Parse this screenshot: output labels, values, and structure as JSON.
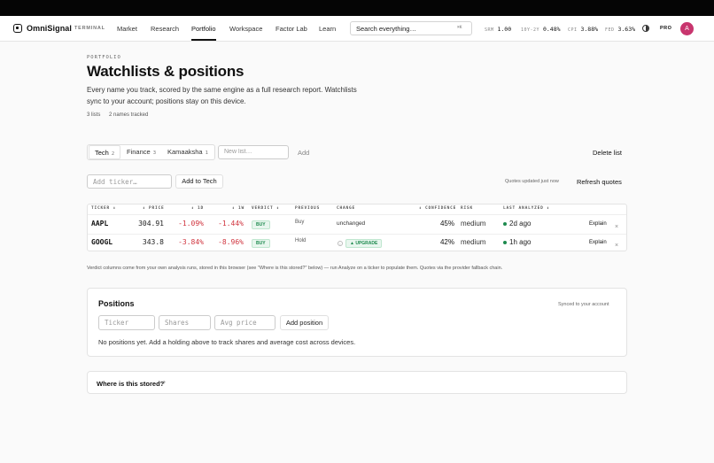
{
  "nav": {
    "brand": "OmniSignal",
    "tag": "TERMINAL",
    "links": [
      "Market",
      "Research",
      "Portfolio",
      "Workspace",
      "Factor Lab",
      "Learn"
    ],
    "active_link": "Portfolio",
    "search_placeholder": "Search everything…",
    "search_shortcut": "⌘K",
    "tickers": [
      {
        "key": "SRM",
        "value": "1.00"
      },
      {
        "key": "10Y-2Y",
        "value": "0.48%"
      },
      {
        "key": "CPI",
        "value": "3.88%"
      },
      {
        "key": "FED",
        "value": "3.63%"
      }
    ],
    "plan": "PRO",
    "avatar_initial": "A",
    "icons": {
      "logo": "omnisignal-logo-icon",
      "theme": "theme-toggle-icon"
    }
  },
  "header": {
    "eyebrow": "PORTFOLIO",
    "title": "Watchlists & positions",
    "description": "Every name you track, scored by the same engine as a full research report. Watchlists sync to your account; positions stay on this device.",
    "lists_count": "3 lists",
    "names_tracked": "2 names tracked"
  },
  "watchlists": {
    "tabs": [
      {
        "label": "Tech",
        "count": "2"
      },
      {
        "label": "Finance",
        "count": "3"
      },
      {
        "label": "Kamaaksha",
        "count": "1"
      }
    ],
    "active_tab": "Tech",
    "new_list_placeholder": "New list…",
    "add_label": "Add",
    "delete_label": "Delete list",
    "ticker_placeholder": "Add ticker…",
    "add_to_label": "Add to Tech",
    "quotes_status": "Quotes updated just now",
    "refresh_label": "Refresh quotes"
  },
  "table": {
    "headers": {
      "ticker": "TICKER ↕",
      "price": "↕ PRICE",
      "d1": "↕ 1D",
      "w1": "↕ 1W",
      "verdict": "VERDICT ↕",
      "previous": "PREVIOUS",
      "change": "CHANGE",
      "confidence": "↕ CONFIDENCE",
      "risk": "RISK",
      "last_analyzed": "LAST ANALYZED ↕"
    },
    "rows": [
      {
        "ticker": "AAPL",
        "price": "304.91",
        "d1": "-1.09%",
        "w1": "-1.44%",
        "verdict": "BUY",
        "previous": "Buy",
        "change": "unchanged",
        "confidence": "45%",
        "risk": "medium",
        "last_analyzed": "2d ago",
        "explain": "Explain",
        "remove": "×"
      },
      {
        "ticker": "GOOGL",
        "price": "343.8",
        "d1": "-3.84%",
        "w1": "-8.96%",
        "verdict": "BUY",
        "previous": "Hold",
        "change": "▲ UPGRADE",
        "change_info": "i",
        "confidence": "42%",
        "risk": "medium",
        "last_analyzed": "1h ago",
        "explain": "Explain",
        "remove": "×"
      }
    ],
    "colors": {
      "negative": "#d0353f",
      "positive": "#1d8a4e"
    }
  },
  "footnote": "Verdict columns come from your own analysis runs, stored in this browser (see \"Where is this stored?\" below) — run Analyze on a ticker to populate them. Quotes via the provider fallback chain.",
  "positions": {
    "title": "Positions",
    "synced": "Synced to your account",
    "ticker_placeholder": "Ticker",
    "shares_placeholder": "Shares",
    "avg_price_placeholder": "Avg price",
    "add_label": "Add position",
    "empty_text": "No positions yet. Add a holding above to track shares and average cost across devices."
  },
  "storage": {
    "label": "Where is this stored?",
    "toggle": "+"
  }
}
